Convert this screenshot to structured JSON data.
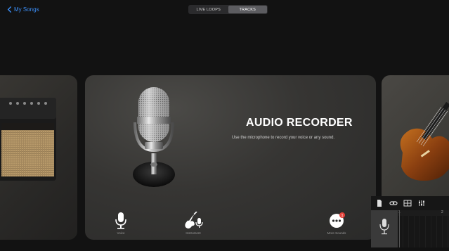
{
  "nav": {
    "back_label": "My Songs"
  },
  "tabs": [
    {
      "label": "LIVE LOOPS",
      "active": false
    },
    {
      "label": "TRACKS",
      "active": true
    }
  ],
  "main_card": {
    "title": "AUDIO RECORDER",
    "subtitle": "Use the microphone to record your voice or any sound."
  },
  "bottom_buttons": {
    "voice": "Voice",
    "instrument": "Instrument",
    "more": "More Sounds",
    "more_badge": "1"
  },
  "timeline": {
    "ruler_start": "1",
    "ruler_next": "2"
  },
  "colors": {
    "accent": "#3b8df5",
    "badge": "#e5413a"
  }
}
